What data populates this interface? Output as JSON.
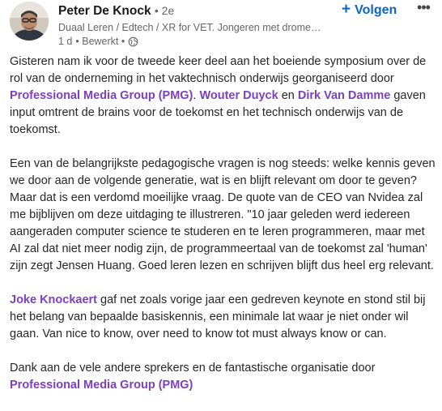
{
  "author": {
    "name": "Peter De Knock",
    "degree": "• 2e",
    "headline": "Duaal Leren / Edtech / XR for VET. Jongeren met dromen toeko...",
    "time": "1 d",
    "edited": "• Bewerkt •",
    "visibility_icon": "globe-icon"
  },
  "actions": {
    "follow_label": "Volgen",
    "follow_icon": "+",
    "more_icon": "•••"
  },
  "colors": {
    "mention": "#7b3fbf",
    "follow": "#0a66c2"
  },
  "post": {
    "p1": {
      "t1": "Gisteren nam ik voor de tweede keer deel aan het boeiende symposium over de rol van de onderneming in het vaktechnisch onderwijs georganiseerd door ",
      "m1": "Professional Media Group (PMG)",
      "t2": ". ",
      "m2": "Wouter Duyck",
      "t3": " en ",
      "m3": "Dirk Van Damme",
      "t4": " gaven input omtrent de brains voor de toekomst en het technisch onderwijs van de toekomst."
    },
    "p2": "Een van de belangrijkste pedagogische vragen is nog steeds: welke kennis geven we door aan de volgende generatie, wat is en blijft relevant om door te geven? Maar dat is een verdomd moeilijke vraag. De quote van de CEO van Nvidea zal me bijblijven om deze uitdaging te illustreren. \"10 jaar geleden werd iedereen aangeraden computer science te studeren en te leren programmeren, maar met AI zal dat niet meer nodig zijn, de programmeertaal van de toekomst zal 'human' zijn zegt Jensen Huang. Goed leren lezen en schrijven blijft dus heel erg relevant.",
    "p3": {
      "m1": "Joke Knockaert",
      "t1": " gaf net zoals vorige jaar een gedreven keynote en stond stil bij het belang van bepaalde basiskennis, een minimale lat waar je niet onder wil gaan. Van nice to know, over need to know tot must always know or can."
    },
    "p4": {
      "t1": "Dank aan de vele andere sprekers en de fantastische organisatie door ",
      "m1": "Professional Media Group (PMG)"
    }
  }
}
